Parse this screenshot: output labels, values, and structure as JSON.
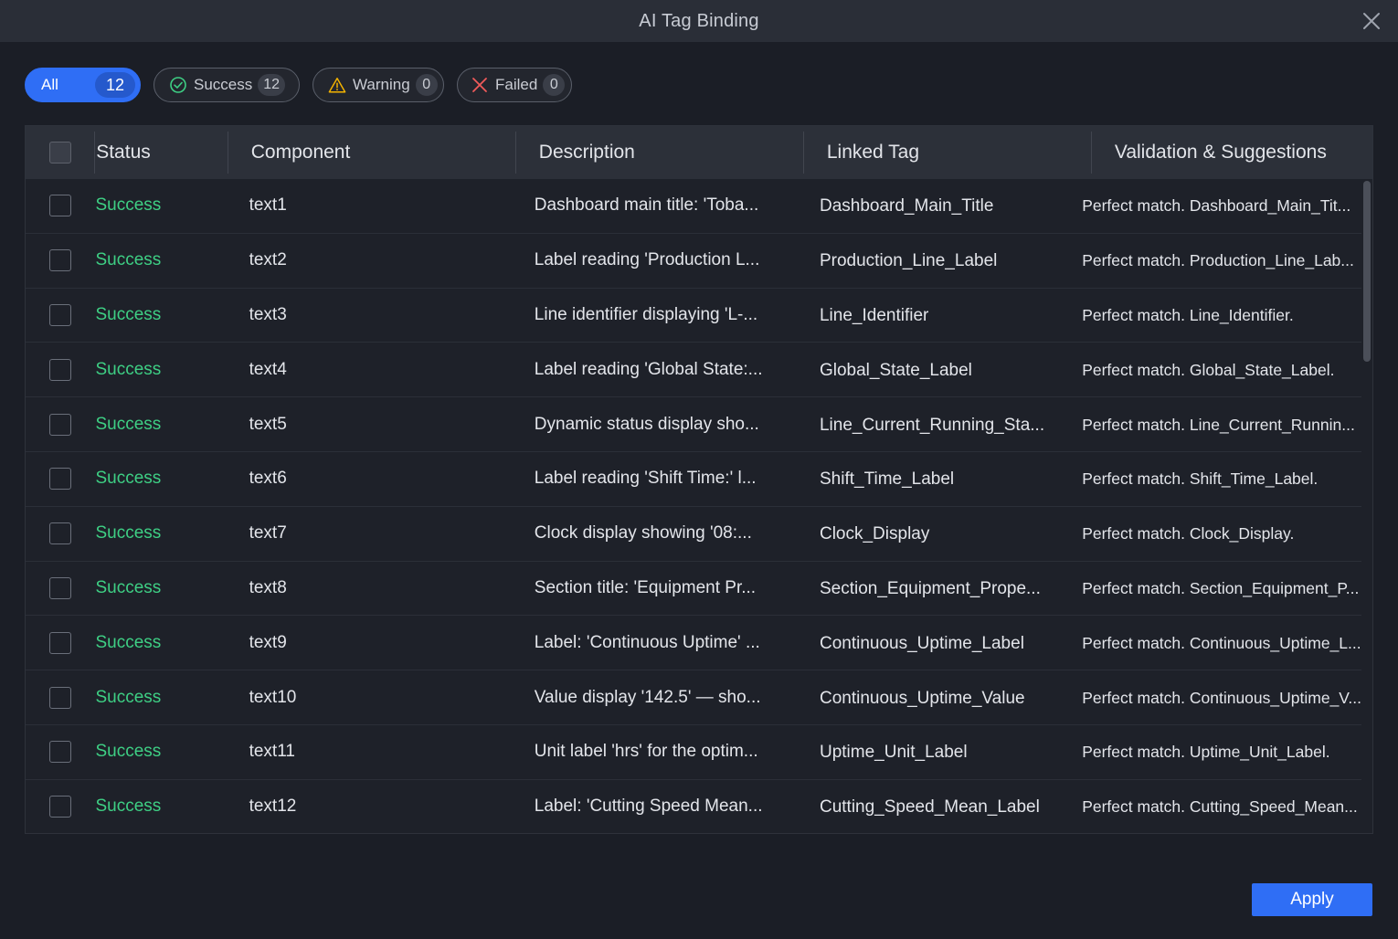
{
  "dialog": {
    "title": "AI Tag Binding"
  },
  "filters": {
    "all": {
      "label": "All",
      "count": "12"
    },
    "success": {
      "label": "Success",
      "count": "12"
    },
    "warning": {
      "label": "Warning",
      "count": "0"
    },
    "failed": {
      "label": "Failed",
      "count": "0"
    }
  },
  "table": {
    "headers": {
      "status": "Status",
      "component": "Component",
      "description": "Description",
      "linked_tag": "Linked Tag",
      "validation": "Validation & Suggestions"
    },
    "rows": [
      {
        "status": "Success",
        "component": "text1",
        "description": "Dashboard main title: 'Toba...",
        "linked_tag": "Dashboard_Main_Title",
        "validation": "Perfect match. Dashboard_Main_Tit..."
      },
      {
        "status": "Success",
        "component": "text2",
        "description": "Label reading 'Production L...",
        "linked_tag": "Production_Line_Label",
        "validation": "Perfect match. Production_Line_Lab..."
      },
      {
        "status": "Success",
        "component": "text3",
        "description": "Line identifier displaying 'L-...",
        "linked_tag": "Line_Identifier",
        "validation": "Perfect match. Line_Identifier."
      },
      {
        "status": "Success",
        "component": "text4",
        "description": "Label reading 'Global State:...",
        "linked_tag": "Global_State_Label",
        "validation": "Perfect match. Global_State_Label."
      },
      {
        "status": "Success",
        "component": "text5",
        "description": "Dynamic status display sho...",
        "linked_tag": "Line_Current_Running_Sta...",
        "validation": "Perfect match. Line_Current_Runnin..."
      },
      {
        "status": "Success",
        "component": "text6",
        "description": "Label reading 'Shift Time:' l...",
        "linked_tag": "Shift_Time_Label",
        "validation": "Perfect match. Shift_Time_Label."
      },
      {
        "status": "Success",
        "component": "text7",
        "description": "Clock display showing '08:...",
        "linked_tag": "Clock_Display",
        "validation": "Perfect match. Clock_Display."
      },
      {
        "status": "Success",
        "component": "text8",
        "description": "Section title: 'Equipment Pr...",
        "linked_tag": "Section_Equipment_Prope...",
        "validation": "Perfect match. Section_Equipment_P..."
      },
      {
        "status": "Success",
        "component": "text9",
        "description": "Label: 'Continuous Uptime' ...",
        "linked_tag": "Continuous_Uptime_Label",
        "validation": "Perfect match. Continuous_Uptime_L..."
      },
      {
        "status": "Success",
        "component": "text10",
        "description": "Value display '142.5' — sho...",
        "linked_tag": "Continuous_Uptime_Value",
        "validation": "Perfect match. Continuous_Uptime_V..."
      },
      {
        "status": "Success",
        "component": "text11",
        "description": "Unit label 'hrs' for the optim...",
        "linked_tag": "Uptime_Unit_Label",
        "validation": "Perfect match. Uptime_Unit_Label."
      },
      {
        "status": "Success",
        "component": "text12",
        "description": "Label: 'Cutting Speed Mean...",
        "linked_tag": "Cutting_Speed_Mean_Label",
        "validation": "Perfect match. Cutting_Speed_Mean..."
      }
    ]
  },
  "footer": {
    "apply_label": "Apply"
  },
  "colors": {
    "accent": "#2f6ef5",
    "success": "#3ecf84",
    "warning": "#f5b400",
    "failed": "#f05a5a"
  },
  "icons": {
    "close": "close-icon",
    "success": "check-circle-icon",
    "warning": "warning-triangle-icon",
    "failed": "x-icon"
  }
}
